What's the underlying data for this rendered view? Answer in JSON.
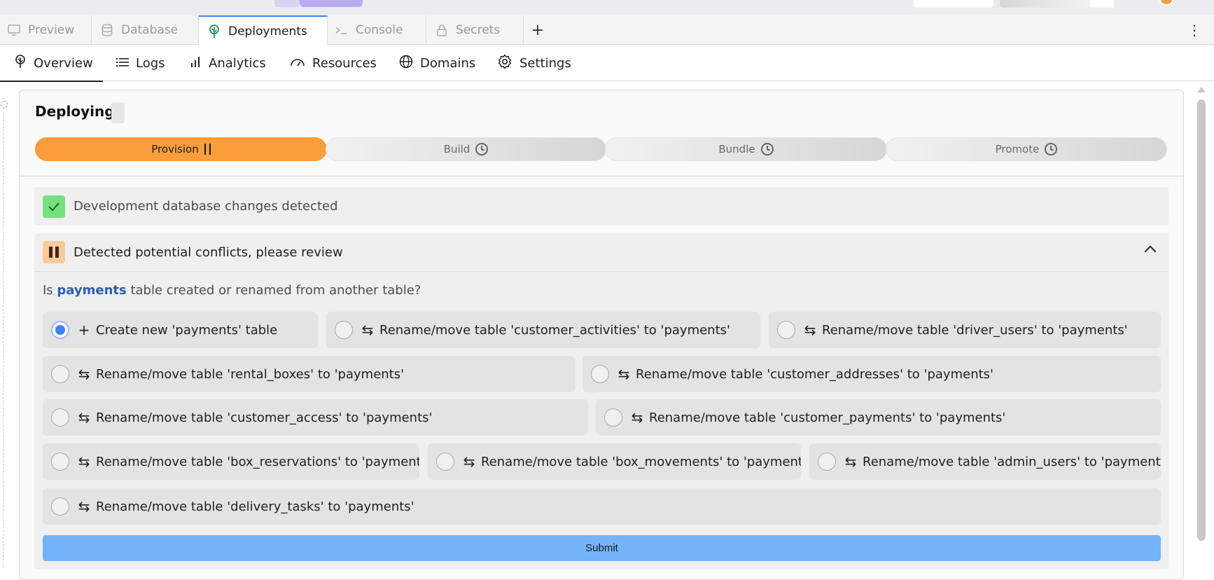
{
  "tabs": [
    {
      "label": "Preview",
      "icon": "monitor-icon"
    },
    {
      "label": "Database",
      "icon": "database-icon"
    },
    {
      "label": "Deployments",
      "icon": "deploy-tree-icon"
    },
    {
      "label": "Console",
      "icon": "terminal-icon"
    },
    {
      "label": "Secrets",
      "icon": "lock-icon"
    }
  ],
  "add_tab_label": "+",
  "more_label": "⋮",
  "subnav": [
    {
      "label": "Overview",
      "icon": "deploy-tree-icon"
    },
    {
      "label": "Logs",
      "icon": "list-icon"
    },
    {
      "label": "Analytics",
      "icon": "bar-chart-icon"
    },
    {
      "label": "Resources",
      "icon": "gauge-icon"
    },
    {
      "label": "Domains",
      "icon": "globe-icon"
    },
    {
      "label": "Settings",
      "icon": "gear-icon"
    }
  ],
  "deploy": {
    "title": "Deploying",
    "steps": [
      {
        "label": "Provision",
        "state": "paused"
      },
      {
        "label": "Build",
        "state": "pending"
      },
      {
        "label": "Bundle",
        "state": "pending"
      },
      {
        "label": "Promote",
        "state": "pending"
      }
    ]
  },
  "checks": {
    "detected": "Development database changes detected",
    "conflicts": "Detected potential conflicts, please review"
  },
  "question": {
    "prefix": "Is",
    "table": "payments",
    "suffix": "table created or renamed from another table?"
  },
  "options": [
    {
      "glyph": "+",
      "label": "Create new 'payments' table",
      "selected": true
    },
    {
      "glyph": "⇆",
      "label": "Rename/move table 'customer_activities' to 'payments'",
      "selected": false
    },
    {
      "glyph": "⇆",
      "label": "Rename/move table 'driver_users' to 'payments'",
      "selected": false
    },
    {
      "glyph": "⇆",
      "label": "Rename/move table 'rental_boxes' to 'payments'",
      "selected": false
    },
    {
      "glyph": "⇆",
      "label": "Rename/move table 'customer_addresses' to 'payments'",
      "selected": false
    },
    {
      "glyph": "⇆",
      "label": "Rename/move table 'customer_access' to 'payments'",
      "selected": false
    },
    {
      "glyph": "⇆",
      "label": "Rename/move table 'customer_payments' to 'payments'",
      "selected": false
    },
    {
      "glyph": "⇆",
      "label": "Rename/move table 'box_reservations' to 'payments'",
      "selected": false
    },
    {
      "glyph": "⇆",
      "label": "Rename/move table 'box_movements' to 'payments'",
      "selected": false
    },
    {
      "glyph": "⇆",
      "label": "Rename/move table 'admin_users' to 'payments'",
      "selected": false
    },
    {
      "glyph": "⇆",
      "label": "Rename/move table 'delivery_tasks' to 'payments'",
      "selected": false
    }
  ],
  "submit_label": "Submit",
  "colors": {
    "accent": "#3b82f6",
    "step_active": "#fb9d3b",
    "success": "#74e07e",
    "warning": "#fcc99a",
    "submit": "#74b4fb",
    "highlight_text": "#2a5db0"
  }
}
